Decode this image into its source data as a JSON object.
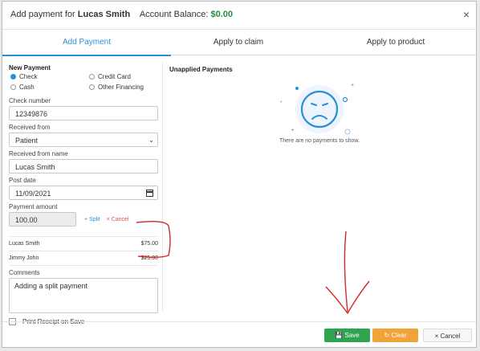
{
  "header": {
    "prefix": "Add payment for",
    "patient_name": "Lucas Smith",
    "balance_label": "Account Balance:",
    "balance_value": "$0.00",
    "close_glyph": "×"
  },
  "tabs": [
    {
      "label": "Add Payment",
      "active": true
    },
    {
      "label": "Apply to claim",
      "active": false
    },
    {
      "label": "Apply to product",
      "active": false
    }
  ],
  "new_payment": {
    "title": "New Payment",
    "methods": [
      "Check",
      "Credit Card",
      "Cash",
      "Other Financing"
    ],
    "selected_method": "Check",
    "check_number_label": "Check number",
    "check_number": "12349876",
    "received_from_label": "Received from",
    "received_from": "Patient",
    "received_from_name_label": "Received from name",
    "received_from_name": "Lucas Smith",
    "post_date_label": "Post date",
    "post_date": "11/09/2021",
    "payment_amount_label": "Payment amount",
    "payment_amount": "100.00",
    "split_label": "Split",
    "cancel_label": "Cancel",
    "splits": [
      {
        "name": "Lucas Smith",
        "amount": "$75.00"
      },
      {
        "name": "Jimmy John",
        "amount": "$25.00"
      }
    ],
    "comments_label": "Comments",
    "comments": "Adding a split payment",
    "print_receipt_label": "Print Receipt on Save"
  },
  "unapplied": {
    "title": "Unapplied Payments",
    "empty_message": "There are no payments to show."
  },
  "footer": {
    "save_label": "Save",
    "clear_label": "Clear",
    "cancel_label": "Cancel"
  },
  "colors": {
    "accent": "#2b8fd6",
    "save": "#2ea44f",
    "clear": "#f0a338",
    "annotation": "#d62828"
  }
}
